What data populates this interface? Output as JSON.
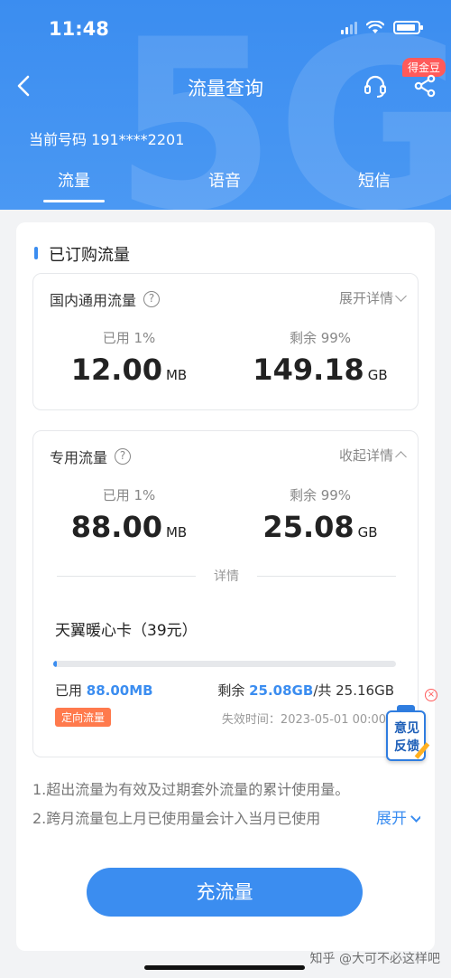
{
  "status_bar": {
    "time": "11:48"
  },
  "nav": {
    "title": "流量查询",
    "badge": "得金豆"
  },
  "phone": {
    "label": "当前号码",
    "number": "191****2201"
  },
  "tabs": [
    {
      "label": "流量"
    },
    {
      "label": "语音"
    },
    {
      "label": "短信"
    }
  ],
  "section": {
    "title": "已订购流量"
  },
  "domestic": {
    "title": "国内通用流量",
    "toggle": "展开详情",
    "used_label": "已用 1%",
    "used_value": "12.00",
    "used_unit": "MB",
    "remain_label": "剩余 99%",
    "remain_value": "149.18",
    "remain_unit": "GB"
  },
  "special": {
    "title": "专用流量",
    "toggle": "收起详情",
    "used_label": "已用 1%",
    "used_value": "88.00",
    "used_unit": "MB",
    "remain_label": "剩余 99%",
    "remain_value": "25.08",
    "remain_unit": "GB",
    "divider_text": "详情",
    "package_name": "天翼暖心卡（39元）",
    "progress_fraction": 0.01,
    "used_prefix": "已用",
    "used_amount": "88.00MB",
    "remain_prefix": "剩余",
    "remain_amount": "25.08GB",
    "total_text": "/共 25.16GB",
    "tag": "定向流量",
    "expire": "失效时间：2023-05-01 00:00:00"
  },
  "notes": {
    "line1": "1.超出流量为有效及过期套外流量的累计使用量。",
    "line2": "2.跨月流量包上月已使用量会计入当月已使用",
    "expand": "展开"
  },
  "recharge_button": "充流量",
  "feedback": {
    "line1": "意见",
    "line2": "反馈"
  },
  "watermark": "知乎 @大可不必这样吧"
}
